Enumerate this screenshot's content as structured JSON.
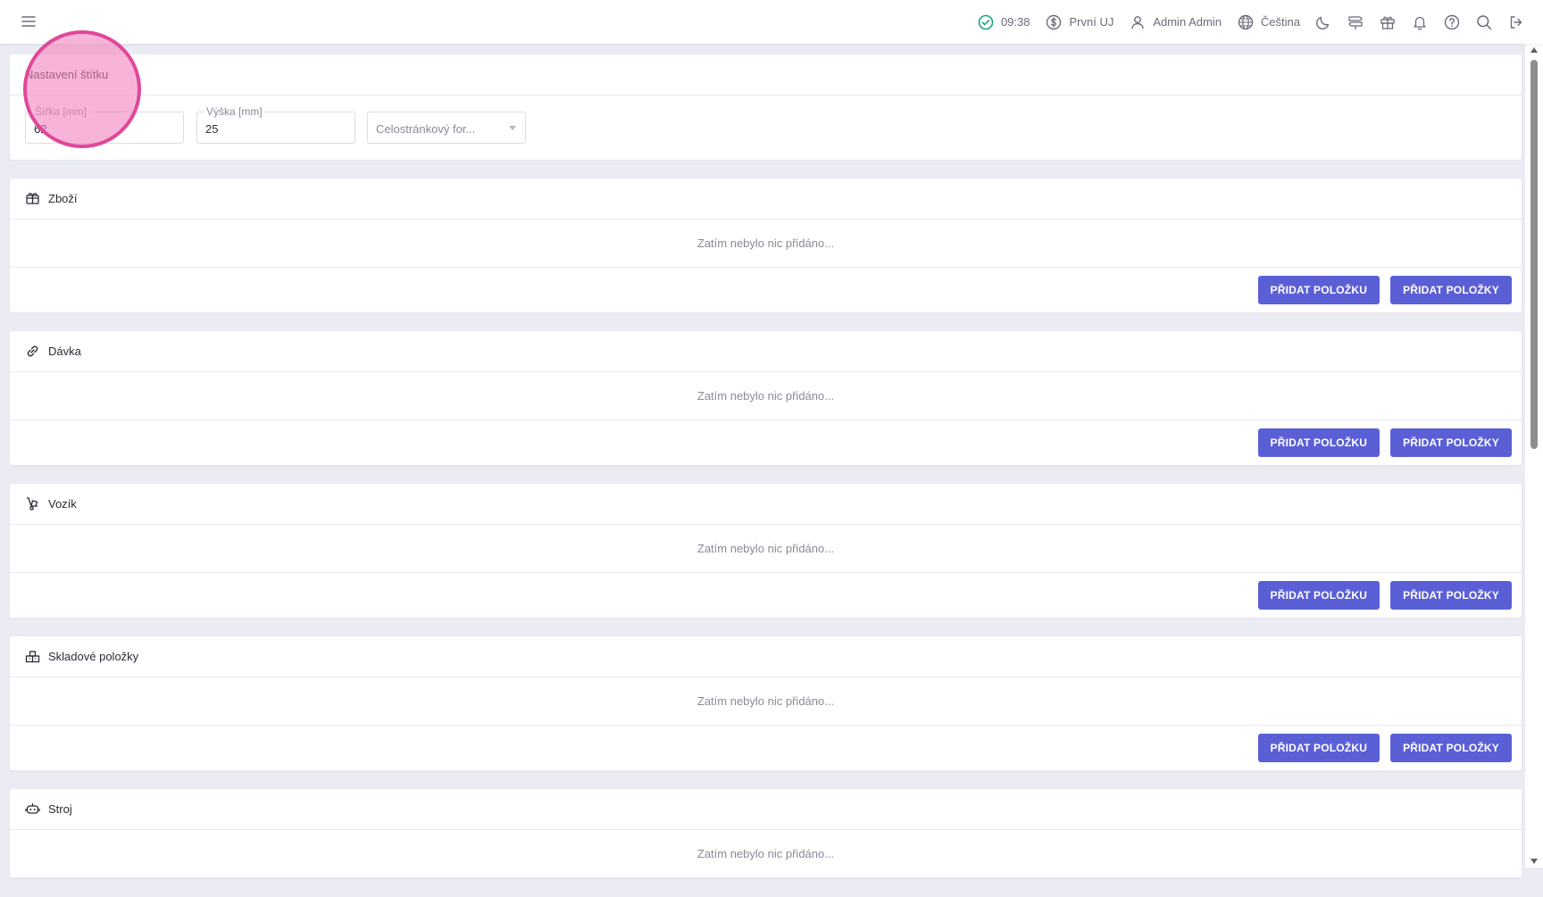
{
  "topbar": {
    "time": "09:38",
    "unit": "První UJ",
    "user": "Admin Admin",
    "language": "Čeština",
    "icons": [
      "menu-icon",
      "check-circle-icon",
      "dollar-icon",
      "user-icon",
      "globe-icon",
      "moon-icon",
      "signpost-icon",
      "gift-icon",
      "bell-icon",
      "help-icon",
      "search-icon",
      "logout-icon"
    ]
  },
  "settings": {
    "title": "Nastavení štítku",
    "width_label": "Šířka [mm]",
    "width_value": "62",
    "height_label": "Výška [mm]",
    "height_value": "25",
    "format_placeholder": "Celostránkový for..."
  },
  "sections": [
    {
      "title": "Zboží",
      "empty": "Zatím nebylo nic přidáno...",
      "add_one": "PŘIDAT POLOŽKU",
      "add_many": "PŘIDAT POLOŽKY"
    },
    {
      "title": "Dávka",
      "empty": "Zatím nebylo nic přidáno...",
      "add_one": "PŘIDAT POLOŽKU",
      "add_many": "PŘIDAT POLOŽKY"
    },
    {
      "title": "Vozík",
      "empty": "Zatím nebylo nic přidáno...",
      "add_one": "PŘIDAT POLOŽKU",
      "add_many": "PŘIDAT POLOŽKY"
    },
    {
      "title": "Skladové položky",
      "empty": "Zatím nebylo nic přidáno...",
      "add_one": "PŘIDAT POLOŽKU",
      "add_many": "PŘIDAT POLOŽKY"
    },
    {
      "title": "Stroj",
      "empty": "Zatím nebylo nic přidáno..."
    }
  ],
  "colors": {
    "accent": "#5a5fd6",
    "status_ok": "#1aa37a",
    "touch": "#e0479a"
  }
}
